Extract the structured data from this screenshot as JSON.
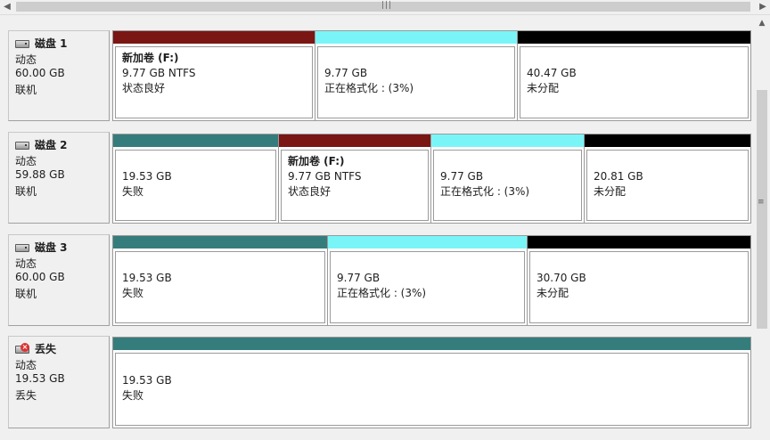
{
  "colors": {
    "primary": "#7a1614",
    "unallocated": "#000000",
    "formatting": "#79f5f8",
    "simple_teal": "#357d7c"
  },
  "disks": [
    {
      "name": "磁盘 1",
      "type": "动态",
      "size": "60.00 GB",
      "status": "联机",
      "icon": "disk-icon",
      "volumes": [
        {
          "name": "新加卷  (F:)",
          "size": "9.77 GB NTFS",
          "status": "状态良好",
          "color": "#7a1614"
        },
        {
          "size": "9.77 GB",
          "status": "正在格式化 : (3%)",
          "color": "#79f5f8"
        },
        {
          "size": "40.47 GB",
          "status": "未分配",
          "color": "#000000"
        }
      ]
    },
    {
      "name": "磁盘 2",
      "type": "动态",
      "size": "59.88 GB",
      "status": "联机",
      "icon": "disk-icon",
      "volumes": [
        {
          "size": "19.53 GB",
          "status": "失败",
          "color": "#357d7c"
        },
        {
          "name": "新加卷  (F:)",
          "size": "9.77 GB NTFS",
          "status": "状态良好",
          "color": "#7a1614"
        },
        {
          "size": "9.77 GB",
          "status": "正在格式化 : (3%)",
          "color": "#79f5f8"
        },
        {
          "size": "20.81 GB",
          "status": "未分配",
          "color": "#000000"
        }
      ]
    },
    {
      "name": "磁盘 3",
      "type": "动态",
      "size": "60.00 GB",
      "status": "联机",
      "icon": "disk-icon",
      "volumes": [
        {
          "size": "19.53 GB",
          "status": "失败",
          "color": "#357d7c"
        },
        {
          "size": "9.77 GB",
          "status": "正在格式化 : (3%)",
          "color": "#79f5f8"
        },
        {
          "size": "30.70 GB",
          "status": "未分配",
          "color": "#000000"
        }
      ]
    },
    {
      "name": "丢失",
      "type": "动态",
      "size": "19.53 GB",
      "status": "丢失",
      "icon": "missing-disk-icon",
      "volumes": [
        {
          "size": "19.53 GB",
          "status": "失败",
          "color": "#357d7c"
        }
      ]
    }
  ]
}
